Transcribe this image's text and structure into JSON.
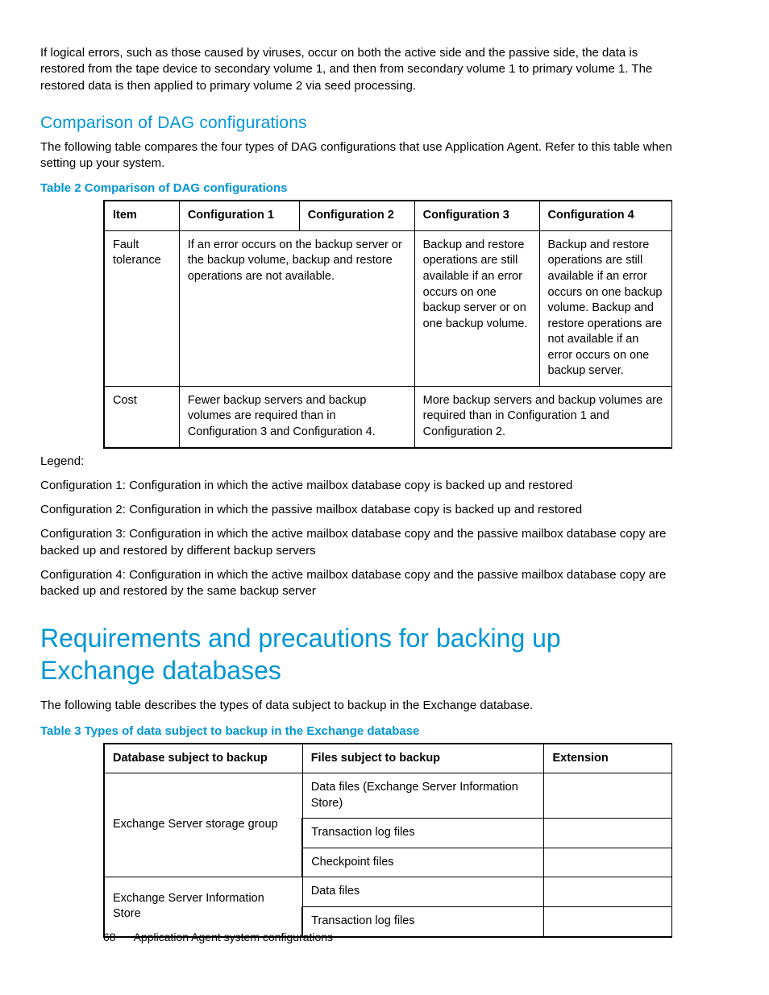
{
  "intro_para": "If logical errors, such as those caused by viruses, occur on both the active side and the passive side, the data is restored from the tape device to secondary volume 1, and then from secondary volume 1 to primary volume 1. The restored data is then applied to primary volume 2 via seed processing.",
  "section1": {
    "heading": "Comparison of DAG configurations",
    "para": "The following table compares the four types of DAG configurations that use Application Agent. Refer to this table when setting up your system.",
    "table_caption": "Table 2 Comparison of DAG configurations",
    "table": {
      "headers": [
        "Item",
        "Configuration 1",
        "Configuration 2",
        "Configuration 3",
        "Configuration 4"
      ],
      "rows": [
        {
          "item": "Fault tolerance",
          "cell12": "If an error occurs on the backup server or the backup volume, backup and restore operations are not available.",
          "cell3": "Backup and restore operations are still available if an error occurs on one backup server or on one backup volume.",
          "cell4": "Backup and restore operations are still available if an error occurs on one backup volume. Backup and restore operations are not available if an error occurs on one backup server."
        },
        {
          "item": "Cost",
          "cell12": "Fewer backup servers and backup volumes are required than in Configuration 3 and Configuration 4.",
          "cell34": "More backup servers and backup volumes are required than in Configuration 1 and Configuration 2."
        }
      ]
    },
    "legend_label": "Legend:",
    "legend": [
      "Configuration 1: Configuration in which the active mailbox database copy is backed up and restored",
      "Configuration 2: Configuration in which the passive mailbox database copy is backed up and restored",
      "Configuration 3: Configuration in which the active mailbox database copy and the passive mailbox database copy are backed up and restored by different backup servers",
      "Configuration 4: Configuration in which the active mailbox database copy and the passive mailbox database copy are backed up and restored by the same backup server"
    ]
  },
  "section2": {
    "heading": "Requirements and precautions for backing up Exchange databases",
    "para": "The following table describes the types of data subject to backup in the Exchange database.",
    "table_caption": "Table 3 Types of data subject to backup in the Exchange database",
    "table": {
      "headers": [
        "Database subject to backup",
        "Files subject to backup",
        "Extension"
      ],
      "rows": [
        {
          "db": "Exchange Server storage group",
          "files": [
            "Data files (Exchange Server Information Store)",
            "Transaction log files",
            "Checkpoint files"
          ]
        },
        {
          "db": "Exchange Server Information Store",
          "files": [
            "Data files",
            "Transaction log files"
          ]
        }
      ]
    }
  },
  "footer": {
    "page": "68",
    "title": "Application Agent system configurations"
  }
}
